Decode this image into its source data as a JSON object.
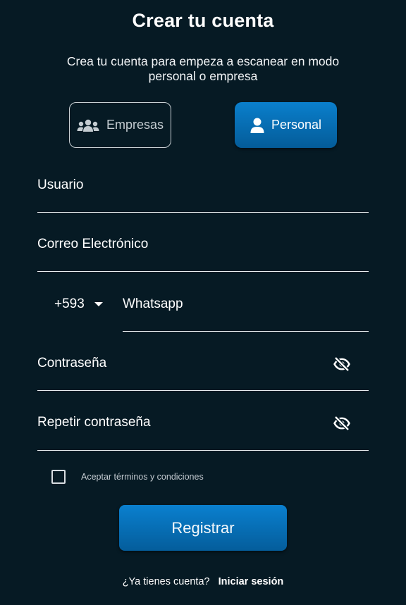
{
  "header": {
    "title": "Crear tu cuenta",
    "subtitle": "Crea tu cuenta para empeza a escanear en modo personal o empresa"
  },
  "account_type": {
    "options": [
      {
        "label": "Empresas",
        "icon": "users-group-icon",
        "selected": false
      },
      {
        "label": "Personal",
        "icon": "user-icon",
        "selected": true
      }
    ]
  },
  "form": {
    "usuario_label": "Usuario",
    "correo_label": "Correo Electrónico",
    "country_code": "+593",
    "whatsapp_label": "Whatsapp",
    "password_label": "Contraseña",
    "repeat_password_label": "Repetir contraseña",
    "terms_label": "Aceptar términos y condiciones",
    "terms_checked": false,
    "submit_label": "Registrar"
  },
  "footer": {
    "question": "¿Ya tienes cuenta?",
    "login_link": "Iniciar sesión"
  },
  "colors": {
    "background": "#061a24",
    "accent": "#0a7fcc",
    "text": "#ffffff"
  }
}
